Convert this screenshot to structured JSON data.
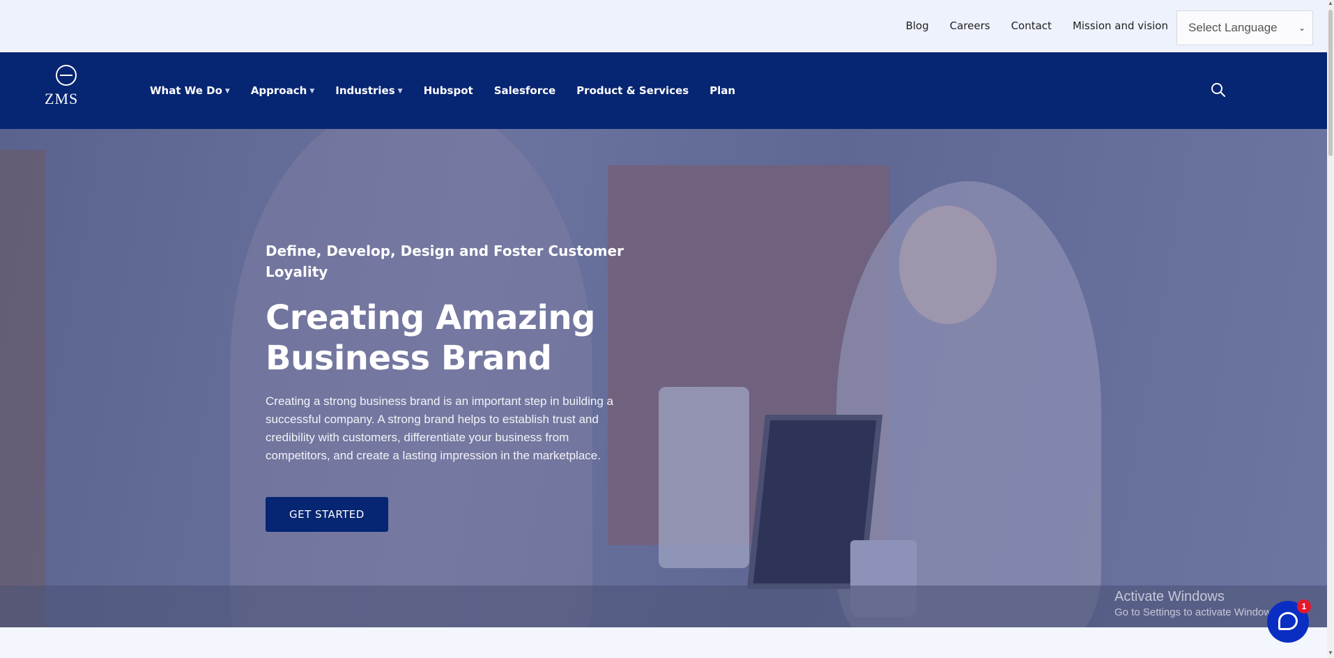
{
  "topbar": {
    "links": [
      "Blog",
      "Careers",
      "Contact",
      "Mission and vision"
    ],
    "language_select": "Select Language"
  },
  "nav": {
    "logo_text": "ZMS",
    "items": [
      {
        "label": "What We Do",
        "has_dropdown": true
      },
      {
        "label": "Approach",
        "has_dropdown": true
      },
      {
        "label": "Industries",
        "has_dropdown": true
      },
      {
        "label": "Hubspot",
        "has_dropdown": false
      },
      {
        "label": "Salesforce",
        "has_dropdown": false
      },
      {
        "label": "Product & Services",
        "has_dropdown": false
      },
      {
        "label": "Plan",
        "has_dropdown": false
      }
    ],
    "search_icon": "search-icon"
  },
  "hero": {
    "kicker": "Define, Develop, Design and Foster Customer Loyality",
    "headline": "Creating Amazing Business Brand",
    "description": "Creating a strong business brand is an important step in building a successful company. A strong brand helps to establish trust and credibility with customers, differentiate your business from competitors, and create a lasting impression in the marketplace.",
    "cta": "GET STARTED"
  },
  "watermark": {
    "line1": "Activate Windows",
    "line2": "Go to Settings to activate Windows."
  },
  "chat": {
    "icon": "chat-icon",
    "badge": "1"
  },
  "colors": {
    "nav_bg": "#062572",
    "cta_bg": "#062572",
    "topbar_bg": "#eef2fc",
    "chat_bg": "#0a2ec2",
    "badge_bg": "#e5182b"
  }
}
